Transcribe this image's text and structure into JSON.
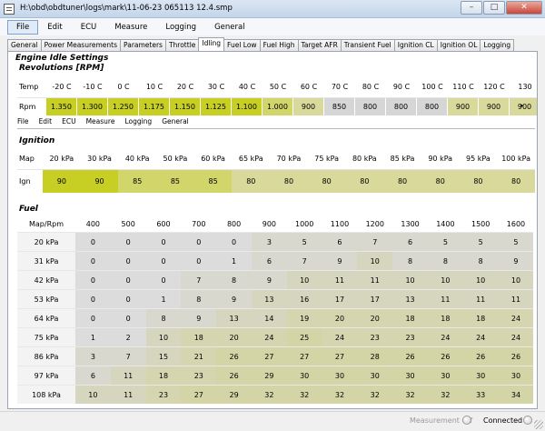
{
  "window": {
    "title": "H:\\obd\\obdtuner\\logs\\mark\\11-06-23 065113 12.4.smp",
    "minimize": "–",
    "maximize": "□",
    "close": "✕"
  },
  "menu": [
    "File",
    "Edit",
    "ECU",
    "Measure",
    "Logging",
    "General"
  ],
  "tabs": [
    "General",
    "Power Measurements",
    "Parameters",
    "Throttle",
    "Idling",
    "Fuel Low",
    "Fuel High",
    "Target AFR",
    "Transient Fuel",
    "Ignition CL",
    "Ignition OL",
    "Logging"
  ],
  "active_tab": "Idling",
  "section_title": "Engine Idle Settings",
  "colors": {
    "yellow_bright": "#c8cf24",
    "yellow_mid": "#d2d56a",
    "yellow_light": "#d8d99a",
    "grey": "#d6d6d6",
    "header_bg": "#ffffff",
    "rowhead_bg": "#f3f3f3"
  },
  "rpm": {
    "title": "Revolutions [RPM]",
    "row_label_top": "Temp",
    "row_label_bottom": "Rpm",
    "temps": [
      "-20 C",
      "-10 C",
      "0 C",
      "10 C",
      "20 C",
      "30 C",
      "40 C",
      "50 C",
      "60 C",
      "70 C",
      "80 C",
      "90 C",
      "100 C",
      "110 C",
      "120 C",
      "130"
    ],
    "values": [
      "1.350",
      "1.300",
      "1.250",
      "1.175",
      "1.150",
      "1.125",
      "1.100",
      "1.000",
      "900",
      "850",
      "800",
      "800",
      "800",
      "900",
      "900",
      "900"
    ]
  },
  "sub_menu": [
    "File",
    "Edit",
    "ECU",
    "Measure",
    "Logging",
    "General"
  ],
  "ignition": {
    "title": "Ignition",
    "row_label_top": "Map",
    "row_label_bottom": "Ign",
    "maps": [
      "20 kPa",
      "30 kPa",
      "40 kPa",
      "50 kPa",
      "60 kPa",
      "65 kPa",
      "70 kPa",
      "75 kPa",
      "80 kPa",
      "85 kPa",
      "90 kPa",
      "95 kPa",
      "100 kPa"
    ],
    "values": [
      "90",
      "90",
      "85",
      "85",
      "85",
      "80",
      "80",
      "80",
      "80",
      "80",
      "80",
      "80",
      "80"
    ]
  },
  "fuel": {
    "title": "Fuel",
    "corner": "Map/Rpm",
    "rpms": [
      "400",
      "500",
      "600",
      "700",
      "800",
      "900",
      "1000",
      "1100",
      "1200",
      "1300",
      "1400",
      "1500",
      "1600"
    ],
    "rows": [
      {
        "map": "20 kPa",
        "values": [
          "0",
          "0",
          "0",
          "0",
          "0",
          "3",
          "5",
          "6",
          "7",
          "6",
          "5",
          "5",
          "5"
        ]
      },
      {
        "map": "31 kPa",
        "values": [
          "0",
          "0",
          "0",
          "0",
          "1",
          "6",
          "7",
          "9",
          "10",
          "8",
          "8",
          "8",
          "9"
        ]
      },
      {
        "map": "42 kPa",
        "values": [
          "0",
          "0",
          "0",
          "7",
          "8",
          "9",
          "10",
          "11",
          "11",
          "10",
          "10",
          "10",
          "10"
        ]
      },
      {
        "map": "53 kPa",
        "values": [
          "0",
          "0",
          "1",
          "8",
          "9",
          "13",
          "16",
          "17",
          "17",
          "13",
          "11",
          "11",
          "11"
        ]
      },
      {
        "map": "64 kPa",
        "values": [
          "0",
          "0",
          "8",
          "9",
          "13",
          "14",
          "19",
          "20",
          "20",
          "18",
          "18",
          "18",
          "24"
        ]
      },
      {
        "map": "75 kPa",
        "values": [
          "1",
          "2",
          "10",
          "18",
          "20",
          "24",
          "25",
          "24",
          "23",
          "23",
          "24",
          "24",
          "24"
        ]
      },
      {
        "map": "86 kPa",
        "values": [
          "3",
          "7",
          "15",
          "21",
          "26",
          "27",
          "27",
          "27",
          "28",
          "26",
          "26",
          "26",
          "26"
        ]
      },
      {
        "map": "97 kPa",
        "values": [
          "6",
          "11",
          "18",
          "23",
          "26",
          "29",
          "30",
          "30",
          "30",
          "30",
          "30",
          "30",
          "30"
        ]
      },
      {
        "map": "108 kPa",
        "values": [
          "10",
          "11",
          "23",
          "27",
          "29",
          "32",
          "32",
          "32",
          "32",
          "32",
          "32",
          "33",
          "34"
        ]
      }
    ]
  },
  "status": {
    "measurement": "Measurement Off",
    "connected": "Connected"
  }
}
